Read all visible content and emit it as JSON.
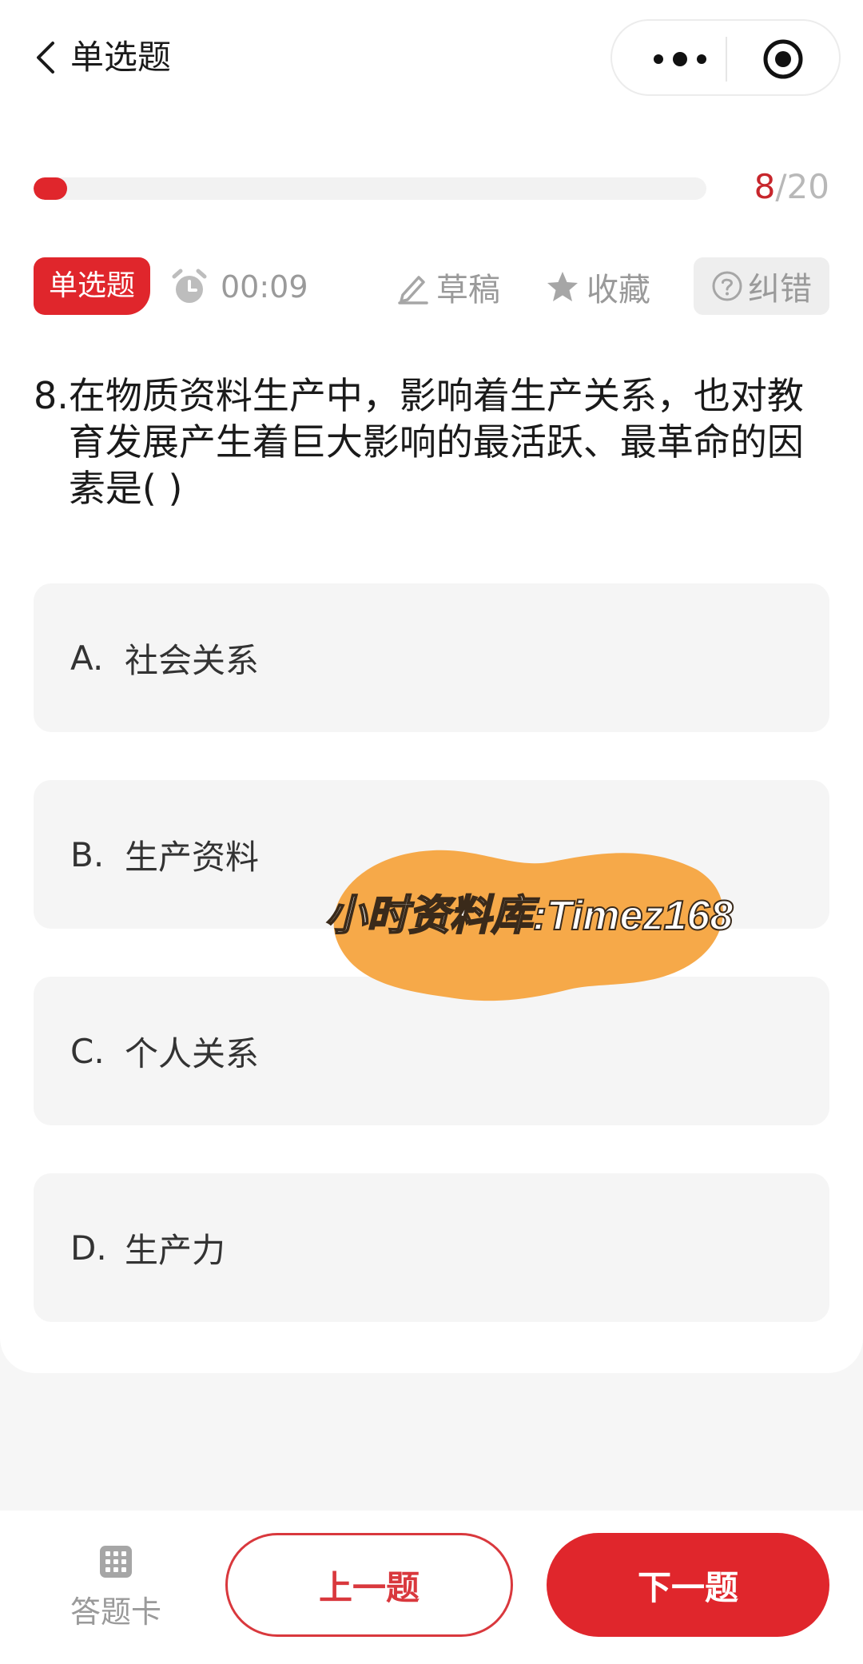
{
  "header": {
    "title": "单选题",
    "back_icon": "chevron-left-icon",
    "more_icon": "more-dots-icon",
    "close_icon": "target-circle-icon"
  },
  "progress": {
    "current": "8",
    "separator": "/",
    "total": "20",
    "fill_fraction": 0.05,
    "color": "#e0262c"
  },
  "meta": {
    "type_tag": "单选题",
    "timer": "00:09",
    "draft_label": "草稿",
    "favorite_label": "收藏",
    "report_label": "纠错"
  },
  "question": {
    "number": "8.",
    "text": "在物质资料生产中，影响着生产关系，也对教育发展产生着巨大影响的最活跃、最革命的因素是( )"
  },
  "options": [
    {
      "letter": "A.",
      "text": "社会关系"
    },
    {
      "letter": "B.",
      "text": "生产资料"
    },
    {
      "letter": "C.",
      "text": "个人关系"
    },
    {
      "letter": "D.",
      "text": "生产力"
    }
  ],
  "watermark": {
    "text": "小时资料库:Timez168"
  },
  "bottom": {
    "answer_sheet_label": "答题卡",
    "prev_label": "上一题",
    "next_label": "下一题"
  },
  "colors": {
    "accent": "#e0262c",
    "watermark": "#f5a23a"
  }
}
